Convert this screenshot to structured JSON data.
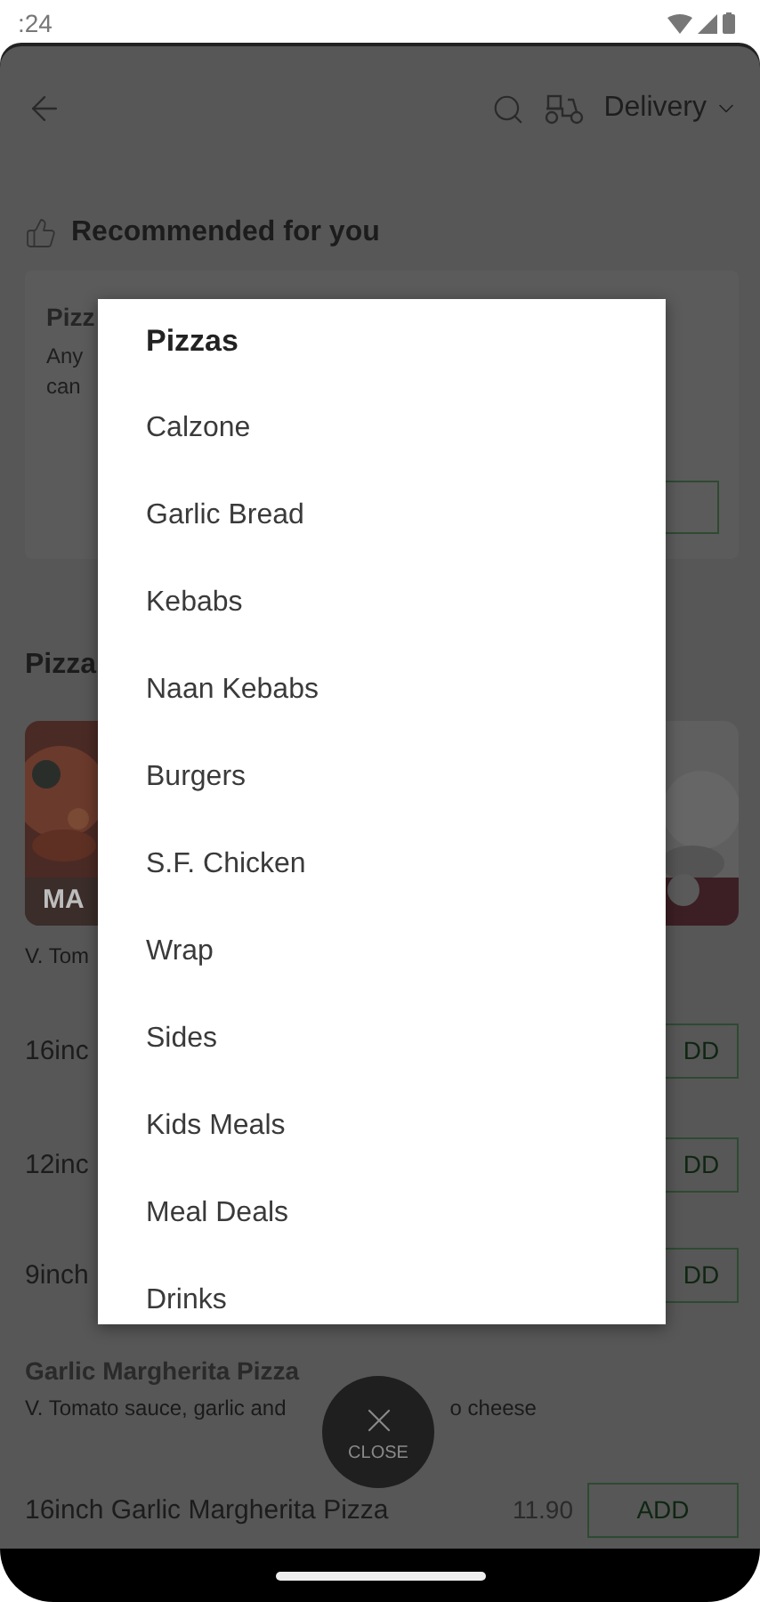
{
  "status_bar": {
    "time": ":24"
  },
  "header": {
    "delivery_mode": "Delivery"
  },
  "recommended": {
    "title": "Recommended for you",
    "card": {
      "title": "Pizz",
      "description_lines": [
        "Any",
        "can"
      ]
    }
  },
  "section": {
    "title": "Pizza",
    "tiles": [
      {
        "kind": "picture",
        "label": "MA"
      },
      {
        "kind": "picture"
      }
    ],
    "description": "V. Tom",
    "items": [
      {
        "name": "16inc",
        "button": "DD"
      },
      {
        "name": "12inc",
        "button": "DD"
      },
      {
        "name": "9inch",
        "button": "DD"
      }
    ]
  },
  "garlic_section": {
    "title": "Garlic Margherita Pizza",
    "description_parts": [
      "V. Tomato sauce, garlic and",
      "o cheese"
    ],
    "item": {
      "name": "16inch Garlic Margherita Pizza",
      "price": "11.90",
      "button": "ADD"
    }
  },
  "menu": {
    "title": "Pizzas",
    "items": [
      "Calzone",
      "Garlic Bread",
      "Kebabs",
      "Naan Kebabs",
      "Burgers",
      "S.F. Chicken",
      "Wrap",
      "Sides",
      "Kids Meals",
      "Meal Deals",
      "Drinks"
    ]
  },
  "close_button": {
    "label": "CLOSE"
  }
}
